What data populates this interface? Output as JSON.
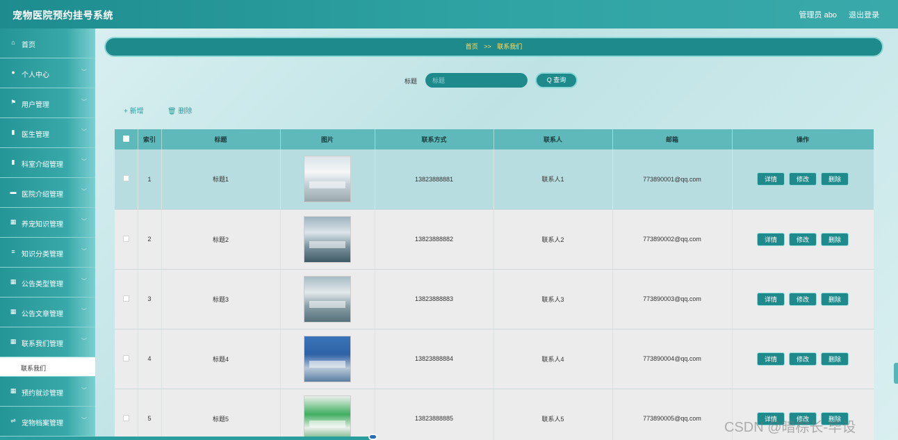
{
  "header": {
    "title": "宠物医院预约挂号系统",
    "admin": "管理员 abo",
    "logout": "退出登录"
  },
  "sidebar": {
    "items": [
      {
        "name": "home",
        "label": "首页",
        "icon": "⌂"
      },
      {
        "name": "personal",
        "label": "个人中心",
        "icon": "●"
      },
      {
        "name": "users",
        "label": "用户管理",
        "icon": "⚑"
      },
      {
        "name": "doctors",
        "label": "医生管理",
        "icon": "▮"
      },
      {
        "name": "departments",
        "label": "科室介绍管理",
        "icon": "▮"
      },
      {
        "name": "hospital",
        "label": "医院介绍管理",
        "icon": "▬"
      },
      {
        "name": "knowledge",
        "label": "养宠知识管理",
        "icon": "▦"
      },
      {
        "name": "knowledge-cat",
        "label": "知识分类管理",
        "icon": "≡"
      },
      {
        "name": "notice-type",
        "label": "公告类型管理",
        "icon": "▦"
      },
      {
        "name": "notice-article",
        "label": "公告文章管理",
        "icon": "▦"
      },
      {
        "name": "contact",
        "label": "联系我们管理",
        "icon": "▦"
      }
    ],
    "subitem": "联系我们",
    "items_after": [
      {
        "name": "appointment",
        "label": "预约就诊管理",
        "icon": "▦"
      },
      {
        "name": "pet-archive",
        "label": "宠物档案管理",
        "icon": "⇌"
      }
    ],
    "chevron": "﹀"
  },
  "breadcrumb": {
    "home": "首页",
    "sep": ">>",
    "current": "联系我们"
  },
  "search": {
    "label": "标题",
    "placeholder": "标题",
    "button": "Q 查询"
  },
  "actions": {
    "add": "+ 新增",
    "delete": "🗑 删除"
  },
  "table": {
    "headers": [
      "索引",
      "标题",
      "图片",
      "联系方式",
      "联系人",
      "邮箱",
      "操作"
    ],
    "rows": [
      {
        "index": "1",
        "title": "标题1",
        "phone": "13823888881",
        "contact": "联系人1",
        "email": "773890001@qq.com"
      },
      {
        "index": "2",
        "title": "标题2",
        "phone": "13823888882",
        "contact": "联系人2",
        "email": "773890002@qq.com"
      },
      {
        "index": "3",
        "title": "标题3",
        "phone": "13823888883",
        "contact": "联系人3",
        "email": "773890003@qq.com"
      },
      {
        "index": "4",
        "title": "标题4",
        "phone": "13823888884",
        "contact": "联系人4",
        "email": "773890004@qq.com"
      },
      {
        "index": "5",
        "title": "标题5",
        "phone": "13823888885",
        "contact": "联系人5",
        "email": "773890005@qq.com"
      }
    ],
    "buttons": {
      "detail": "详情",
      "edit": "修改",
      "delete": "删除"
    }
  },
  "watermark": "CSDN @暗棕长-毕设",
  "colors": {
    "primary": "#1f8a8c",
    "accent": "#2a9d9e",
    "breadcrumb_text": "#ffe066"
  }
}
